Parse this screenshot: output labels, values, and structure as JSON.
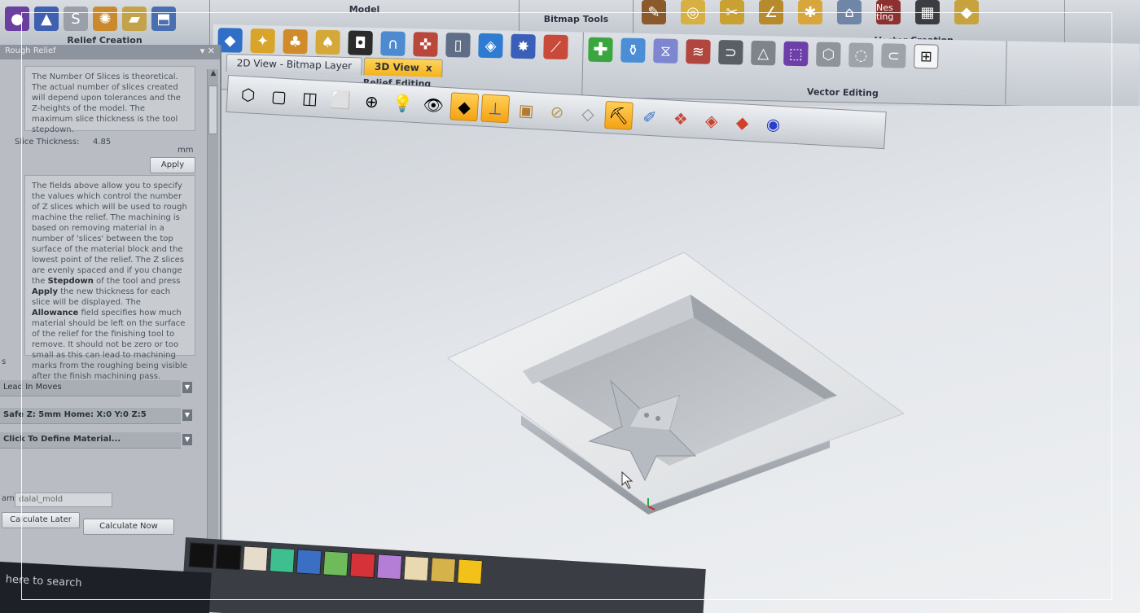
{
  "ribbon": {
    "groups": [
      {
        "label": "Relief Creation",
        "icons": [
          "sphere-icon",
          "pyramid-icon",
          "swirl-icon",
          "texture-icon",
          "layers-icon",
          "import-icon"
        ]
      },
      {
        "label": "Model",
        "icons": [
          "relief-icon",
          "merge-icon"
        ]
      },
      {
        "label": "Bitmap Tools",
        "icons": [
          "paint-icon",
          "fill-icon"
        ]
      },
      {
        "label": "Vector Creation",
        "icons": [
          "pen-icon",
          "circle-icon",
          "scissors-icon",
          "text-icon",
          "nest-icon"
        ]
      }
    ],
    "nesting_label": "Nes ting"
  },
  "ribbon2": {
    "relief_editing_label": "Relief Editing",
    "vector_editing_label": "Vector Editing"
  },
  "left_panel": {
    "title": "Rough Relief",
    "help_top": "The Number Of Slices is theoretical. The actual number of slices created will depend upon tolerances and the Z-heights of the model. The maximum slice thickness is the tool stepdown.",
    "slice_label": "Slice Thickness:",
    "slice_value": "4.85",
    "slice_unit": "mm",
    "apply_label": "Apply",
    "help_bottom_1": "The fields above allow you to specify the values which control the number of Z slices which will be used to rough machine the relief. The machining is based on removing material in a number of 'slices' between the top surface of the material block and the lowest point of the relief. The Z slices are evenly spaced and if you change the ",
    "help_bottom_stepdown": "Stepdown",
    "help_bottom_2": " of the tool and press ",
    "help_bottom_apply": "Apply",
    "help_bottom_3": " the new thickness for each slice will be displayed. The ",
    "help_bottom_allowance": "Allowance",
    "help_bottom_4": " field specifies how much material should be left on the surface of the relief for the finishing tool to remove. It should not be zero or too small as this can lead to machining marks from the roughing being visible after the finish machining pass.",
    "section_letter": "s",
    "lead_in": "Lead In Moves",
    "safe_z": "Safe Z: 5mm Home: X:0 Y:0 Z:5",
    "material": "Click To Define Material...",
    "name_label": "ame:",
    "name_value": "dalal_mold",
    "calc_later": "Calculate Later",
    "calc_now": "Calculate Now"
  },
  "tabs": [
    {
      "label": "2D View - Bitmap Layer"
    },
    {
      "label": "3D View",
      "close": "x"
    }
  ],
  "view_toolbar": {
    "icons": [
      "iso-view-icon",
      "front-view-icon",
      "side-view-icon",
      "top-view-icon",
      "zoom-icon",
      "light-icon",
      "eye-icon",
      "plane-icon",
      "axes-icon",
      "block-icon",
      "cylinder-icon",
      "material-icon",
      "toolpath-icon",
      "brush-icon",
      "tiles-icon",
      "layer-icon",
      "layer-red-icon",
      "target-icon"
    ]
  },
  "palette": {
    "colors": [
      "#111111",
      "#e6dccb",
      "#3fbf8f",
      "#3b6fc4",
      "#6fba5a",
      "#d6323a",
      "#b47ed6",
      "#ead9b0",
      "#d6b24a",
      "#f2c21a"
    ]
  },
  "taskbar": {
    "search": "here to search"
  }
}
